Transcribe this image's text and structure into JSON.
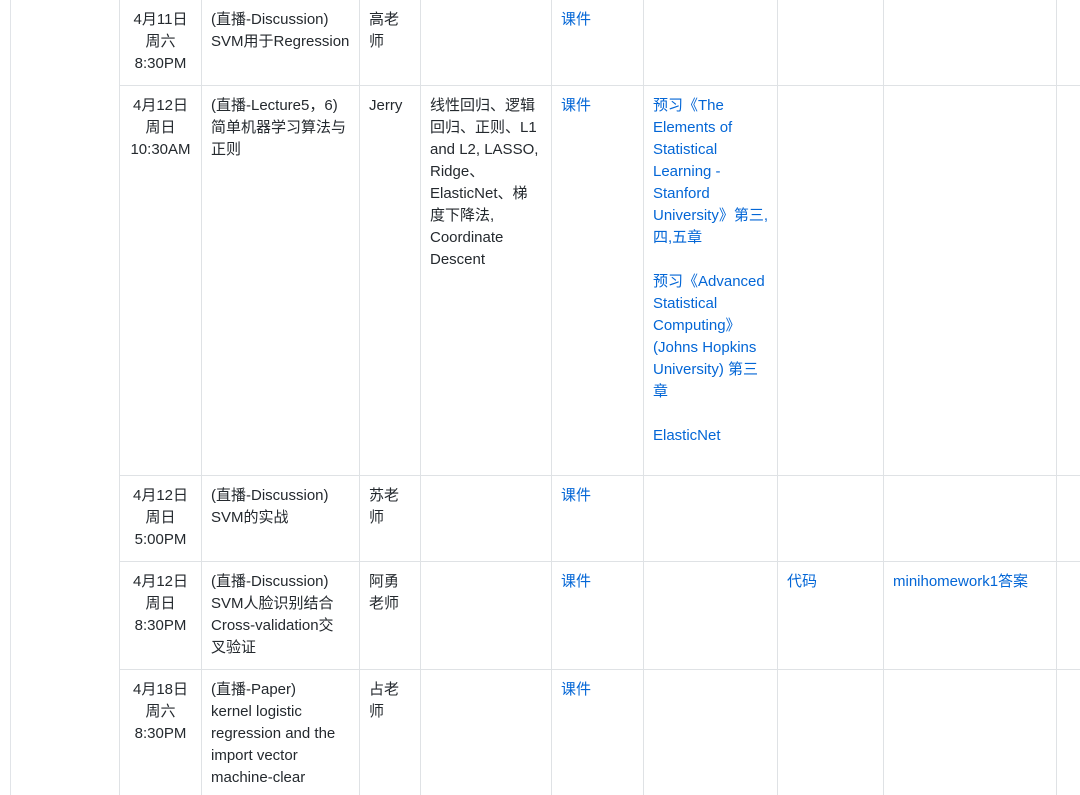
{
  "rows": [
    {
      "date": "4月11日",
      "weekday": "周六",
      "time": "8:30PM",
      "topic": [
        "(直播-Discussion)",
        "SVM用于Regression"
      ],
      "teacher": "高老师",
      "content": "",
      "slides": "课件",
      "reading": "",
      "code": "",
      "homework": ""
    },
    {
      "date": "4月12日",
      "weekday": "周日",
      "time": "10:30AM",
      "topic": [
        "(直播-Lecture5，6)",
        "简单机器学习算法与",
        "正则"
      ],
      "teacher": "Jerry",
      "content": "线性回归、逻辑回归、正则、L1 and L2, LASSO, Ridge、ElasticNet、梯度下降法, Coordinate Descent",
      "slides": "课件",
      "reading_1": "预习《The Elements of Statistical Learning - Stanford University》第三,四,五章",
      "reading_2": "预习《Advanced Statistical Computing》(Johns Hopkins University) 第三章",
      "reading_3": "ElasticNet",
      "code": "",
      "homework": ""
    },
    {
      "date": "4月12日",
      "weekday": "周日",
      "time": "5:00PM",
      "topic": [
        "(直播-Discussion)",
        "SVM的实战"
      ],
      "teacher": "苏老师",
      "content": "",
      "slides": "课件",
      "reading": "",
      "code": "",
      "homework": ""
    },
    {
      "date": "4月12日",
      "weekday": "周日",
      "time": "8:30PM",
      "topic": [
        "(直播-Discussion)",
        "SVM人脸识别结合",
        "Cross-validation交",
        "叉验证"
      ],
      "teacher": "阿勇老师",
      "content": "",
      "slides": "课件",
      "reading": "",
      "code": "代码",
      "homework": "minihomework1答案"
    },
    {
      "date": "4月18日",
      "weekday": "周六",
      "time": "8:30PM",
      "topic": [
        "(直播-Paper)",
        "kernel logistic",
        "regression and the",
        "import vector",
        "machine-clear"
      ],
      "teacher": "占老师",
      "content": "",
      "slides": "课件",
      "reading": "",
      "code": "",
      "homework": ""
    }
  ]
}
